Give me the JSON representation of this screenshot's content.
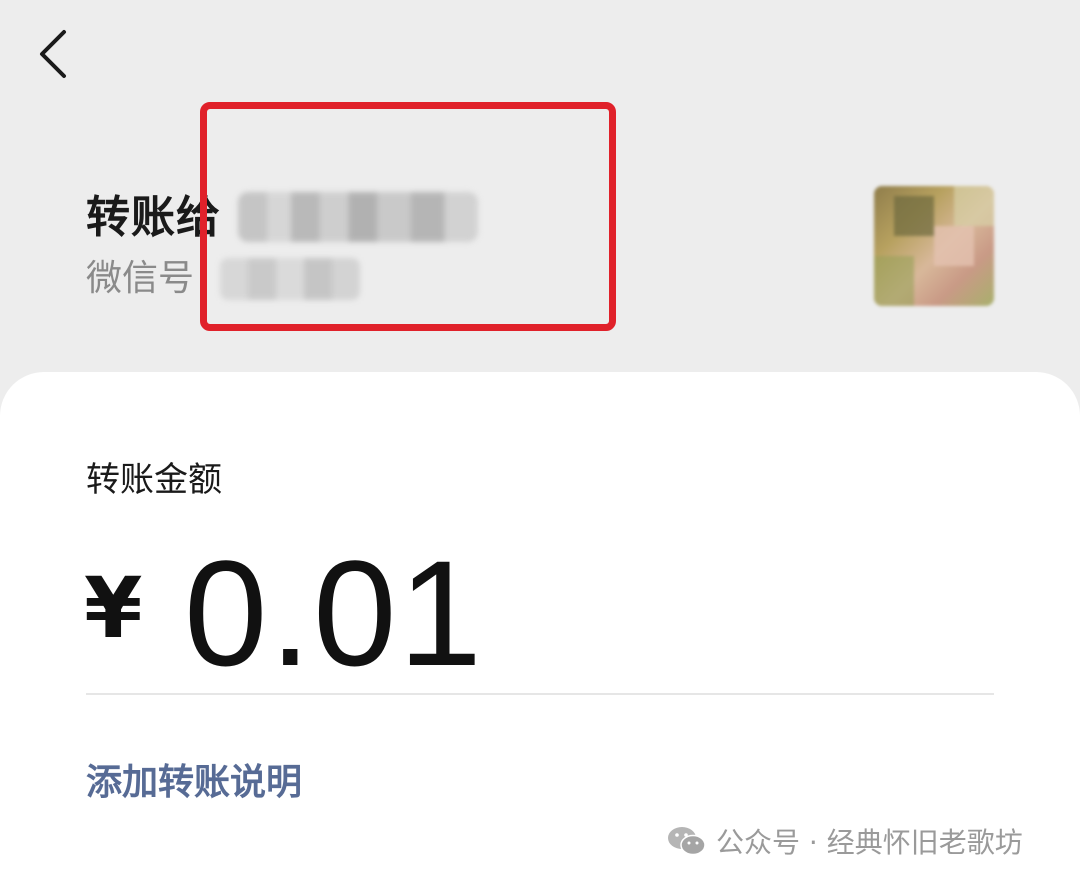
{
  "header": {
    "back_icon": "chevron-left-icon"
  },
  "recipient": {
    "title_prefix": "转账给",
    "wechat_id_label": "微信号",
    "avatar_icon": "avatar-image"
  },
  "highlight_color": "#e0212a",
  "transfer": {
    "amount_label": "转账金额",
    "currency_symbol": "¥",
    "amount": "0.01",
    "add_note_label": "添加转账说明",
    "link_color": "#576b95"
  },
  "watermark": {
    "icon": "wechat-icon",
    "text": "公众号 · 经典怀旧老歌坊"
  }
}
